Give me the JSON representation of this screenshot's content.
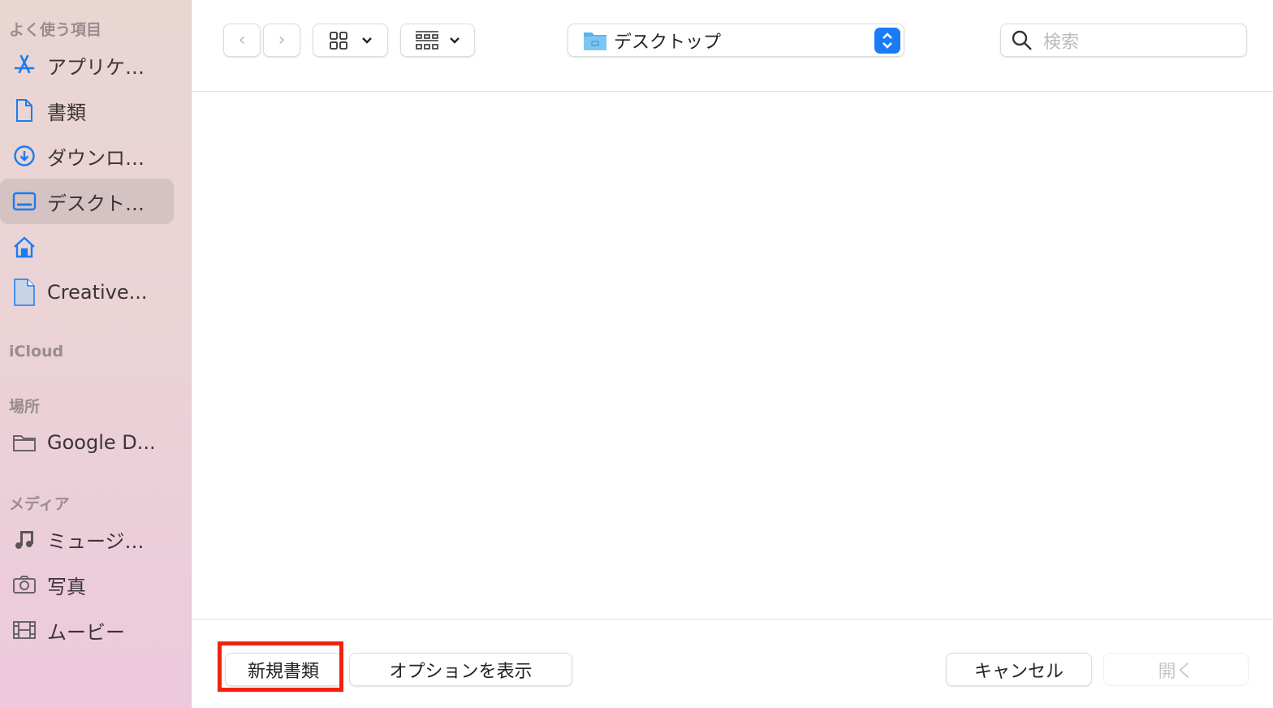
{
  "sidebar": {
    "sections": {
      "favorites": "よく使う項目",
      "icloud": "iCloud",
      "locations": "場所",
      "media": "メディア"
    },
    "favorites": [
      {
        "label": "アプリケ…",
        "icon": "app-store-icon"
      },
      {
        "label": "書類",
        "icon": "document-icon"
      },
      {
        "label": "ダウンロ…",
        "icon": "download-icon"
      },
      {
        "label": "デスクト…",
        "icon": "desktop-icon",
        "selected": true
      },
      {
        "label": "",
        "icon": "home-icon"
      },
      {
        "label": "Creative...",
        "icon": "file-icon"
      }
    ],
    "locations": [
      {
        "label": "Google D...",
        "icon": "folder-icon"
      }
    ],
    "media": [
      {
        "label": "ミュージ…",
        "icon": "music-icon"
      },
      {
        "label": "写真",
        "icon": "camera-icon"
      },
      {
        "label": "ムービー",
        "icon": "film-icon"
      }
    ]
  },
  "toolbar": {
    "location": "デスクトップ",
    "search_placeholder": "検索"
  },
  "footer": {
    "new_document": "新規書類",
    "show_options": "オプションを表示",
    "cancel": "キャンセル",
    "open": "開く"
  },
  "colors": {
    "accent": "#1a7cf5",
    "highlight": "#f2220e"
  }
}
